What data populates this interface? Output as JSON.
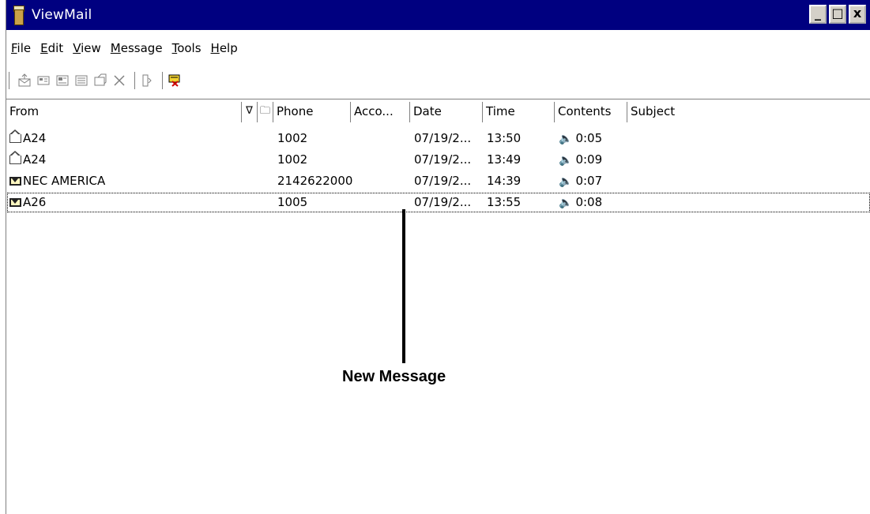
{
  "window": {
    "title": "ViewMail",
    "buttons": {
      "minimize": "_",
      "maximize": "□",
      "close": "x"
    }
  },
  "menu": [
    {
      "underline": "F",
      "rest": "ile"
    },
    {
      "underline": "E",
      "rest": "dit"
    },
    {
      "underline": "V",
      "rest": "iew"
    },
    {
      "underline": "M",
      "rest": "essage"
    },
    {
      "underline": "T",
      "rest": "ools"
    },
    {
      "underline": "H",
      "rest": "elp"
    }
  ],
  "toolbar": {
    "icons": [
      "compose-icon",
      "reply-icon",
      "reply-all-icon",
      "forward-icon",
      "save-icon",
      "delete-icon",
      "properties-icon",
      "address-book-icon"
    ]
  },
  "columns": {
    "from": "From",
    "priority": "∇",
    "folder": "🗀",
    "phone": "Phone",
    "account": "Acco...",
    "date": "Date",
    "time": "Time",
    "contents": "Contents",
    "subject": "Subject"
  },
  "messages": [
    {
      "status": "read",
      "from": "A24",
      "phone": "1002",
      "date": "07/19/2...",
      "time": "13:50",
      "contents": "0:05",
      "subject": ""
    },
    {
      "status": "read",
      "from": "A24",
      "phone": "1002",
      "date": "07/19/2...",
      "time": "13:49",
      "contents": "0:09",
      "subject": ""
    },
    {
      "status": "new",
      "from": "NEC AMERICA",
      "phone": "2142622000",
      "date": "07/19/2...",
      "time": "14:39",
      "contents": "0:07",
      "subject": ""
    },
    {
      "status": "new",
      "from": "A26",
      "phone": "1005",
      "date": "07/19/2...",
      "time": "13:55",
      "contents": "0:08",
      "subject": ""
    }
  ],
  "annotation": {
    "label": "New Message"
  }
}
